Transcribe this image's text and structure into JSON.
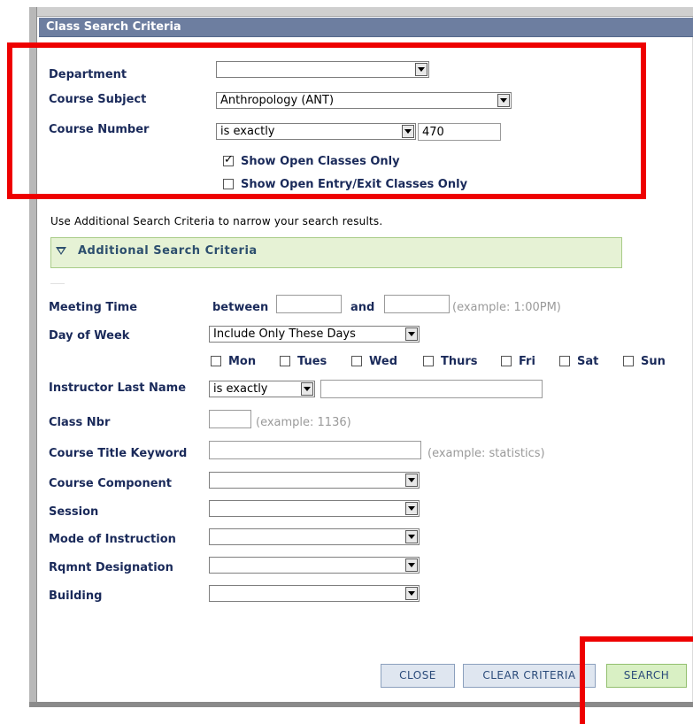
{
  "header": {
    "title": "Class Search Criteria"
  },
  "form": {
    "department": {
      "label": "Department",
      "value": ""
    },
    "course_subject": {
      "label": "Course Subject",
      "value": "Anthropology (ANT)"
    },
    "course_number": {
      "label": "Course Number",
      "operator": "is exactly",
      "value": "470"
    },
    "show_open": {
      "label": "Show Open Classes Only",
      "checked": true
    },
    "show_open_entry": {
      "label": "Show Open Entry/Exit Classes Only",
      "checked": false
    }
  },
  "help_text": "Use Additional Search Criteria to narrow your search results.",
  "additional": {
    "title": "Additional Search Criteria",
    "meeting_time": {
      "label": "Meeting Time",
      "between": "between",
      "and": "and",
      "start": "",
      "end": "",
      "example": "(example: 1:00PM)"
    },
    "day_of_week": {
      "label": "Day of Week",
      "value": "Include Only These Days",
      "days": [
        "Mon",
        "Tues",
        "Wed",
        "Thurs",
        "Fri",
        "Sat",
        "Sun"
      ]
    },
    "instructor": {
      "label": "Instructor Last Name",
      "operator": "is exactly",
      "value": ""
    },
    "class_nbr": {
      "label": "Class Nbr",
      "value": "",
      "example": "(example: 1136)"
    },
    "title_keyword": {
      "label": "Course Title Keyword",
      "value": "",
      "example": "(example: statistics)"
    },
    "course_component": {
      "label": "Course Component",
      "value": ""
    },
    "session": {
      "label": "Session",
      "value": ""
    },
    "mode": {
      "label": "Mode of Instruction",
      "value": ""
    },
    "rqmnt": {
      "label": "Rqmnt Designation",
      "value": ""
    },
    "building": {
      "label": "Building",
      "value": ""
    }
  },
  "buttons": {
    "close": "CLOSE",
    "clear": "CLEAR CRITERIA",
    "search": "SEARCH"
  },
  "colors": {
    "header_bg": "#6d7ea0",
    "highlight": "#ee0000",
    "advanced_bg": "#e6f2d5",
    "label": "#1a2a5a"
  }
}
